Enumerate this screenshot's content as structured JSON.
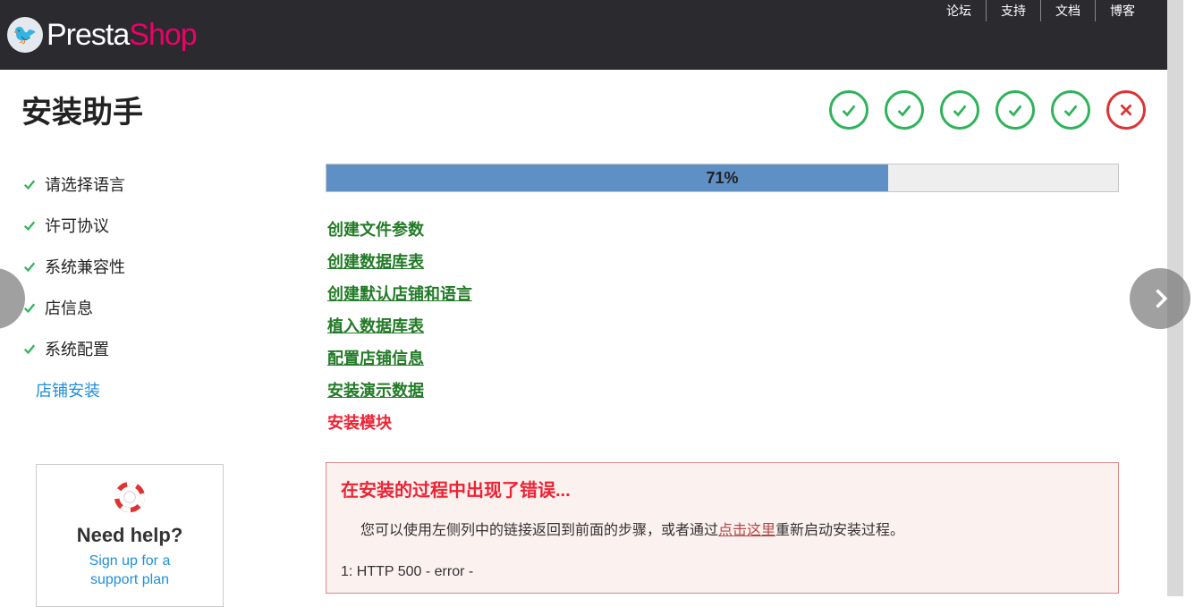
{
  "top_links": [
    "论坛",
    "支持",
    "文档",
    "博客"
  ],
  "logo": {
    "a": "Presta",
    "b": "Shop"
  },
  "page_title": "安装助手",
  "step_circles": [
    {
      "kind": "ok"
    },
    {
      "kind": "ok"
    },
    {
      "kind": "ok"
    },
    {
      "kind": "ok"
    },
    {
      "kind": "ok"
    },
    {
      "kind": "fail"
    }
  ],
  "sidebar": {
    "items": [
      {
        "label": "请选择语言",
        "state": "done"
      },
      {
        "label": "许可协议",
        "state": "done"
      },
      {
        "label": "系统兼容性",
        "state": "done"
      },
      {
        "label": "店信息",
        "state": "done"
      },
      {
        "label": "系统配置",
        "state": "done"
      },
      {
        "label": "店铺安装",
        "state": "active"
      }
    ]
  },
  "help": {
    "title": "Need help?",
    "line1": "Sign up for a",
    "line2": "support plan"
  },
  "progress": {
    "percent": 71,
    "label": "71%"
  },
  "tasks": [
    {
      "label": "创建文件参数",
      "state": "done",
      "first": true
    },
    {
      "label": "创建数据库表",
      "state": "done"
    },
    {
      "label": "创建默认店铺和语言",
      "state": "done"
    },
    {
      "label": "植入数据库表",
      "state": "done"
    },
    {
      "label": "配置店铺信息",
      "state": "done"
    },
    {
      "label": "安装演示数据",
      "state": "done"
    },
    {
      "label": "安装模块",
      "state": "error"
    }
  ],
  "errorbox": {
    "title": "在安装的过程中出现了错误...",
    "msg_before": "您可以使用左侧列中的链接返回到前面的步骤，或者通过",
    "link": "点击这里",
    "msg_after": "重新启动安装过程。",
    "code": "1: HTTP 500 - error -"
  }
}
